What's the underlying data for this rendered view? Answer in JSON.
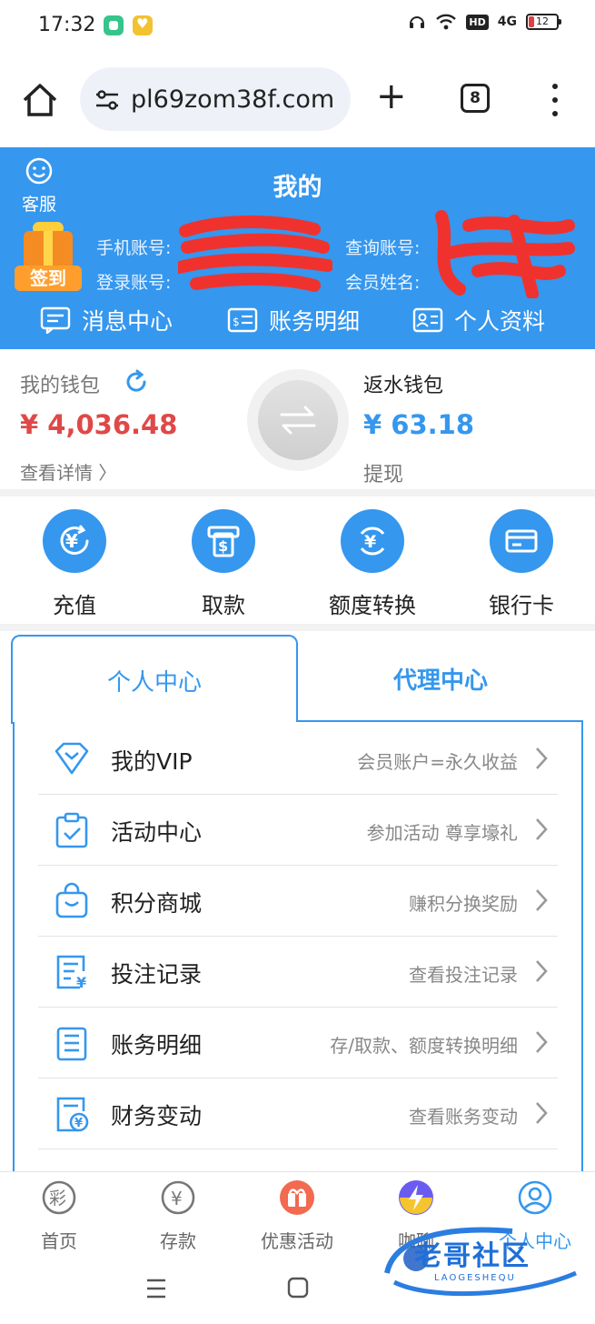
{
  "status_bar": {
    "time": "17:32",
    "hd": "HD",
    "network": "4G",
    "battery": "12"
  },
  "browser": {
    "url": "pl69zom38f.com",
    "tab_count": "8"
  },
  "header": {
    "title": "我的",
    "service_label": "客服",
    "signin_label": "签到",
    "phone_label": "手机账号:",
    "login_label": "登录账号:",
    "query_label": "查询账号:",
    "member_label": "会员姓名:",
    "quick_links": [
      "消息中心",
      "账务明细",
      "个人资料"
    ]
  },
  "wallet": {
    "my_wallet_label": "我的钱包",
    "my_wallet_amount": "¥ 4,036.48",
    "view_details": "查看详情 〉",
    "rebate_label": "返水钱包",
    "rebate_amount": "¥ 63.18",
    "withdraw_label": "提现"
  },
  "actions": [
    "充值",
    "取款",
    "额度转换",
    "银行卡"
  ],
  "tabs": {
    "personal": "个人中心",
    "agent": "代理中心"
  },
  "menu": [
    {
      "title": "我的VIP",
      "desc": "会员账户=永久收益",
      "icon": "diamond-icon"
    },
    {
      "title": "活动中心",
      "desc": "参加活动 尊享壕礼",
      "icon": "clipboard-check-icon"
    },
    {
      "title": "积分商城",
      "desc": "赚积分换奖励",
      "icon": "shopping-bag-icon"
    },
    {
      "title": "投注记录",
      "desc": "查看投注记录",
      "icon": "bet-record-icon"
    },
    {
      "title": "账务明细",
      "desc": "存/取款、额度转换明细",
      "icon": "ledger-icon"
    },
    {
      "title": "财务变动",
      "desc": "查看账务变动",
      "icon": "finance-icon"
    }
  ],
  "bottom_nav": [
    "首页",
    "存款",
    "优惠活动",
    "咖聊",
    "个人中心"
  ],
  "watermark": {
    "text": "老哥社区",
    "sub": "LAOGESHEQU"
  },
  "colors": {
    "primary": "#3597ee",
    "red_amount": "#e04848"
  }
}
